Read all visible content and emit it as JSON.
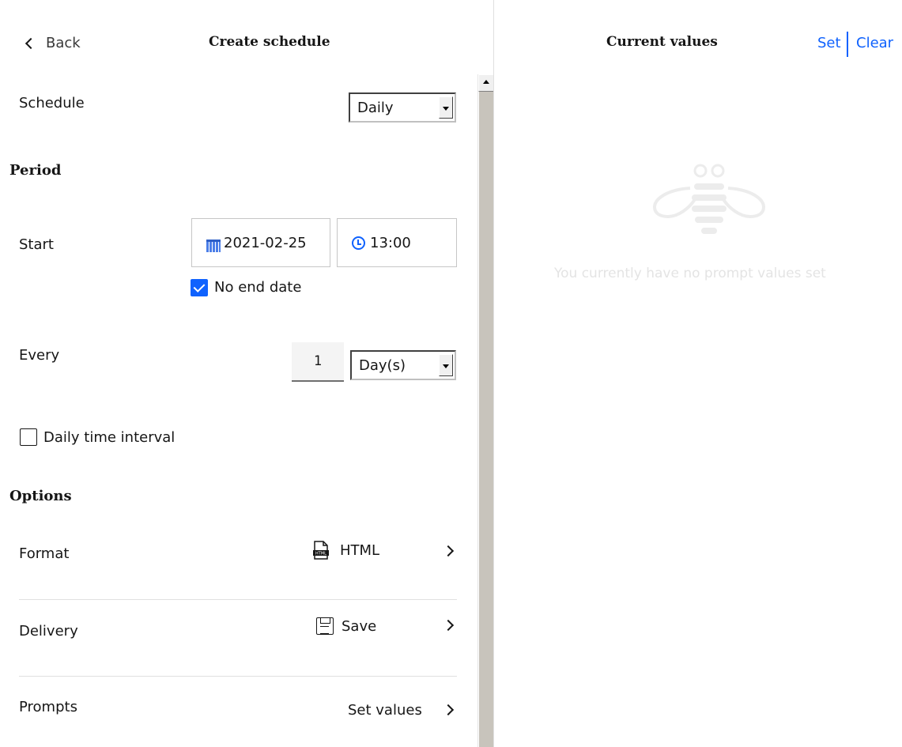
{
  "left_panel": {
    "back_label": "Back",
    "title": "Create schedule",
    "schedule": {
      "label": "Schedule",
      "value": "Daily"
    },
    "period": {
      "heading": "Period",
      "start_label": "Start",
      "start_date": "2021-02-25",
      "start_time": "13:00",
      "no_end_date_label": "No end date",
      "no_end_date_checked": true
    },
    "every": {
      "label": "Every",
      "number": "1",
      "unit": "Day(s)"
    },
    "daily_interval": {
      "label": "Daily time interval",
      "checked": false
    },
    "options": {
      "heading": "Options",
      "format": {
        "label": "Format",
        "value": "HTML"
      },
      "delivery": {
        "label": "Delivery",
        "value": "Save"
      },
      "prompts": {
        "label": "Prompts",
        "value": "Set values"
      }
    }
  },
  "right_panel": {
    "title": "Current values",
    "set_label": "Set",
    "clear_label": "Clear",
    "empty_message": "You currently have no prompt values set",
    "empty_icon": "bee-icon"
  },
  "colors": {
    "accent": "#0f62fe",
    "empty_text": "#e4e4e4"
  }
}
